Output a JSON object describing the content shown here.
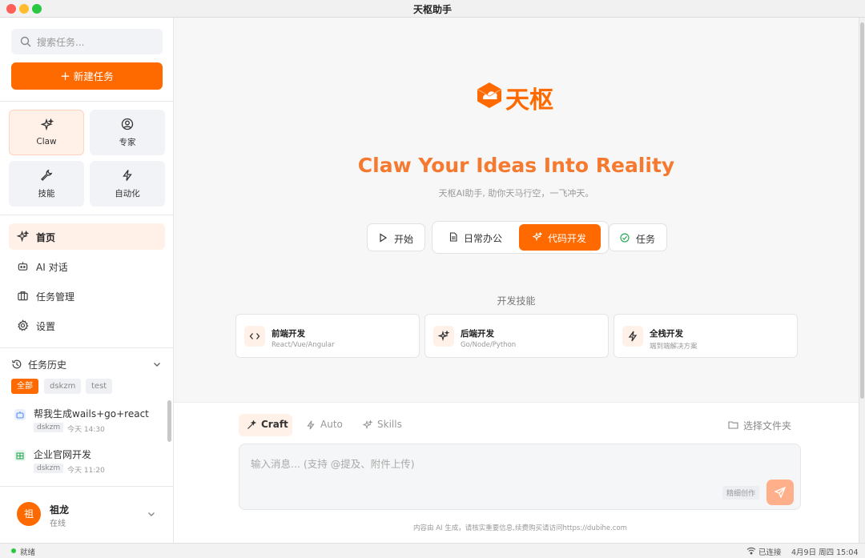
{
  "window": {
    "title": "天枢助手"
  },
  "sidebar": {
    "search_placeholder": "搜索任务...",
    "new_task_label": "新建任务",
    "modes": [
      {
        "label": "Claw",
        "icon": "sparkles-icon",
        "active": true
      },
      {
        "label": "专家",
        "icon": "user-circle-icon",
        "active": false
      },
      {
        "label": "技能",
        "icon": "wrench-icon",
        "active": false
      },
      {
        "label": "自动化",
        "icon": "lightning-icon",
        "active": false
      }
    ],
    "nav": [
      {
        "label": "首页",
        "icon": "sparkles-icon",
        "active": true
      },
      {
        "label": "AI 对话",
        "icon": "bot-icon",
        "active": false
      },
      {
        "label": "任务管理",
        "icon": "briefcase-icon",
        "active": false
      },
      {
        "label": "设置",
        "icon": "gear-icon",
        "active": false
      }
    ],
    "history": {
      "title": "任务历史",
      "filters": [
        "全部",
        "dskzm",
        "test"
      ],
      "active_filter": "全部",
      "items": [
        {
          "title": "帮我生成wails+go+react",
          "tag": "dskzm",
          "time": "今天 14:30",
          "icon": "bot-icon"
        },
        {
          "title": "企业官网开发",
          "tag": "dskzm",
          "time": "今天 11:20",
          "icon": "building-icon"
        }
      ]
    },
    "user": {
      "avatar_text": "祖",
      "name": "祖龙",
      "status": "在线"
    }
  },
  "main": {
    "logo_text": "天枢",
    "hero_title": "Claw Your Ideas Into Reality",
    "subtitle": "天枢AI助手, 助你天马行空，一飞冲天。",
    "start_label": "开始",
    "segments": [
      {
        "label": "日常办公",
        "icon": "document-icon",
        "active": false
      },
      {
        "label": "代码开发",
        "icon": "sparkles-icon",
        "active": true
      }
    ],
    "task_label": "任务",
    "skills_title": "开发技能",
    "skills": [
      {
        "title": "前端开发",
        "desc": "React/Vue/Angular",
        "icon": "code-icon"
      },
      {
        "title": "后端开发",
        "desc": "Go/Node/Python",
        "icon": "sparkles-icon"
      },
      {
        "title": "全栈开发",
        "desc": "端到端解决方案",
        "icon": "lightning-icon"
      }
    ]
  },
  "composer": {
    "tabs": [
      {
        "label": "Craft",
        "icon": "wand-icon",
        "active": true
      },
      {
        "label": "Auto",
        "icon": "lightning-icon",
        "active": false
      },
      {
        "label": "Skills",
        "icon": "sparkles-icon",
        "active": false
      }
    ],
    "folder_label": "选择文件夹",
    "input_placeholder": "输入消息... (支持 @提及、附件上传)",
    "mode_badge": "精细创作",
    "disclaimer": "内容由 AI 生成，请核实重要信息,续费购买请访问https://dubihe.com"
  },
  "statusbar": {
    "ready": "就绪",
    "connection": "已连接",
    "clock": "4月9日 周四 15:04"
  },
  "colors": {
    "accent": "#ff6a00",
    "accent_soft": "#fff0e8",
    "hero": "#f57a30"
  }
}
